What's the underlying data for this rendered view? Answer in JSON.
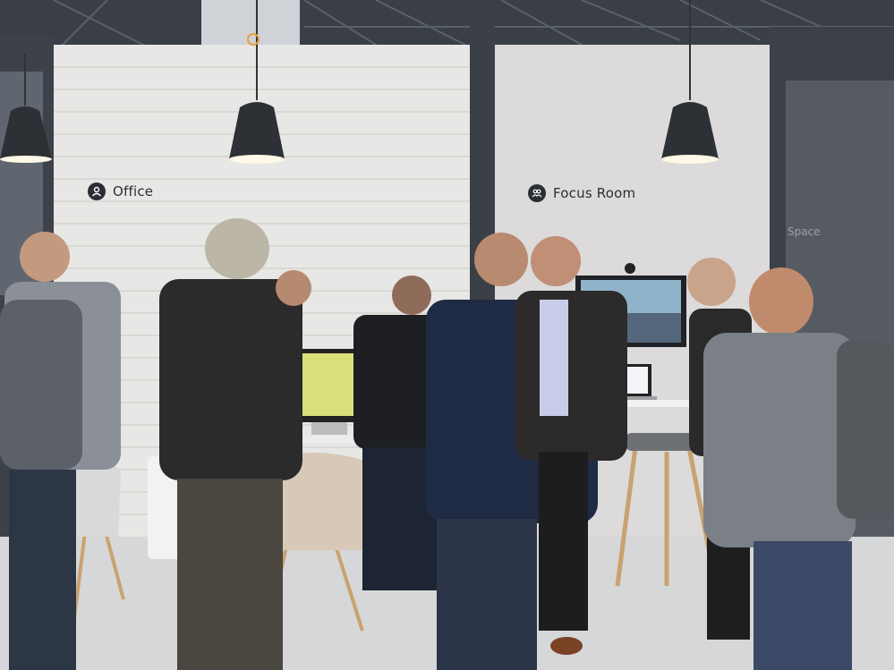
{
  "scene": {
    "description_colors": {
      "brick_wall": "#e7e7e5",
      "focus_wall": "#dcdadb",
      "ceiling": "#3a3f47",
      "floor": "#d6d7d8",
      "lamp": "#2d3035"
    }
  },
  "signs": {
    "office": {
      "label": "Office",
      "icon": "person-icon"
    },
    "focus_room": {
      "label": "Focus Room",
      "icon": "group-icon"
    },
    "space": {
      "label": "Space"
    }
  }
}
